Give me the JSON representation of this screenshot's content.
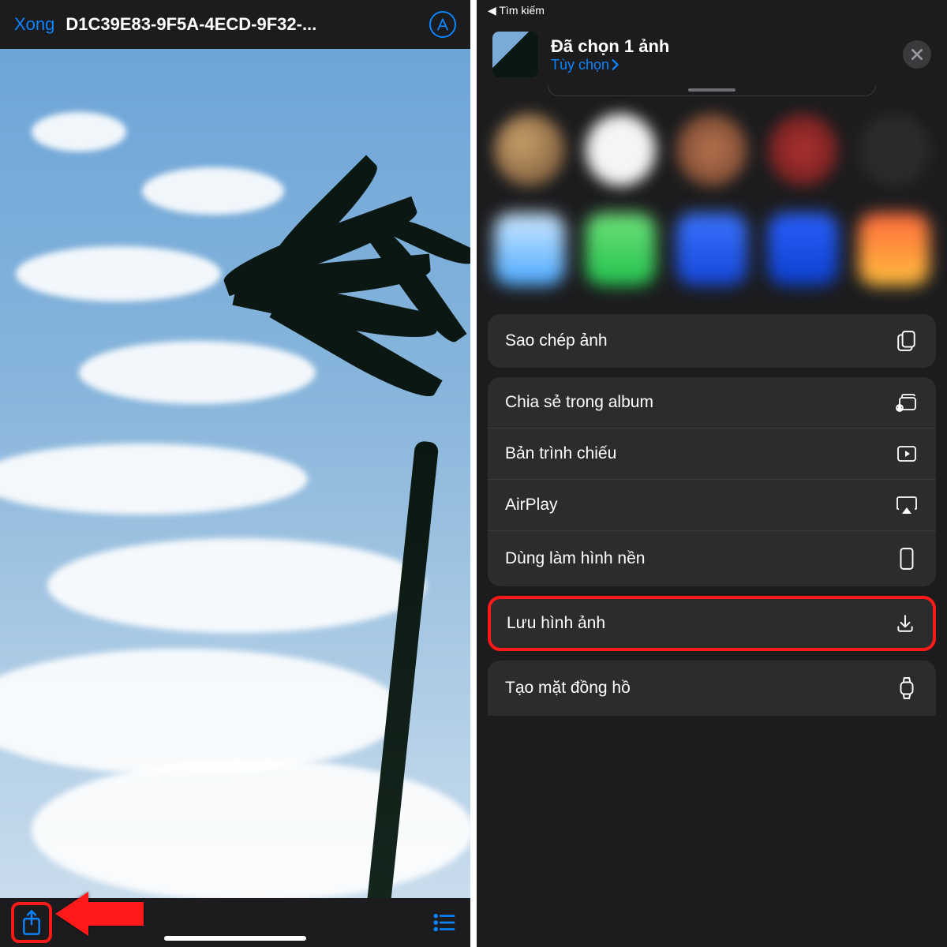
{
  "left": {
    "done_label": "Xong",
    "file_title": "D1C39E83-9F5A-4ECD-9F32-..."
  },
  "right": {
    "status_back": "◀ Tìm kiếm",
    "sheet_title": "Đã chọn 1 ảnh",
    "options_label": "Tùy chọn",
    "actions": {
      "copy_photo": "Sao chép ảnh",
      "share_album": "Chia sẻ trong album",
      "slideshow": "Bản trình chiếu",
      "airplay": "AirPlay",
      "set_wallpaper": "Dùng làm hình nền",
      "save_image": "Lưu hình ảnh",
      "create_watchface": "Tạo mặt đồng hồ"
    }
  },
  "colors": {
    "accent": "#0a84ff",
    "highlight": "#ff1a1a"
  }
}
